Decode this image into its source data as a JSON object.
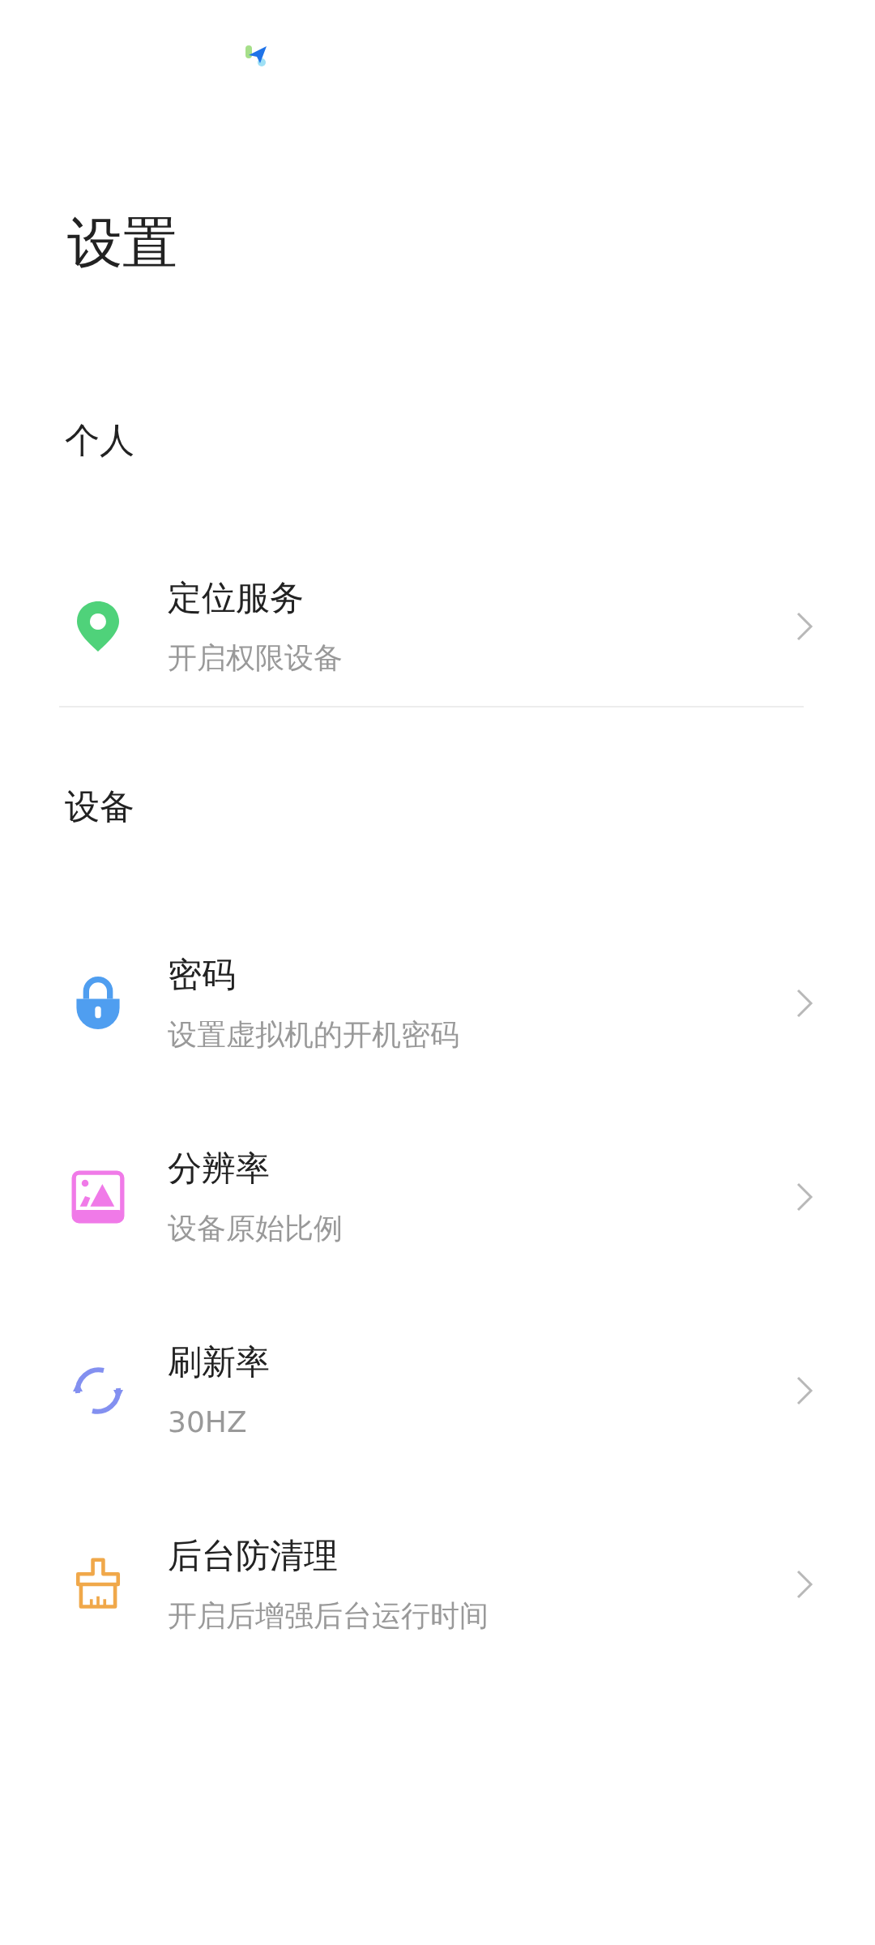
{
  "title": "设置",
  "sections": [
    {
      "heading": "个人",
      "divider": true,
      "items": [
        {
          "kind": "location",
          "title": "定位服务",
          "subtitle": "开启权限设备"
        }
      ]
    },
    {
      "heading": "设备",
      "divider": false,
      "items": [
        {
          "kind": "lock",
          "title": "密码",
          "subtitle": "设置虚拟机的开机密码"
        },
        {
          "kind": "image",
          "title": "分辨率",
          "subtitle": "设备原始比例"
        },
        {
          "kind": "refresh",
          "title": "刷新率",
          "subtitle": "30HZ"
        },
        {
          "kind": "brush",
          "title": "后台防清理",
          "subtitle": "开启后增强后台运行时间"
        }
      ]
    }
  ]
}
